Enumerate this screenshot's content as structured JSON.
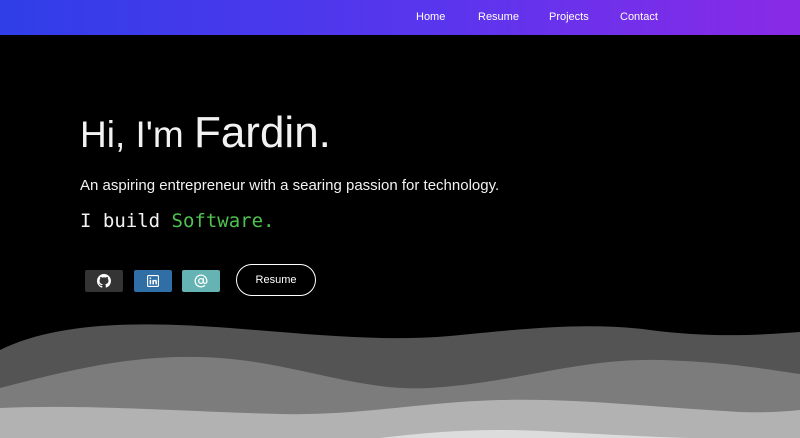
{
  "nav": {
    "items": [
      {
        "label": "Home"
      },
      {
        "label": "Resume"
      },
      {
        "label": "Projects"
      },
      {
        "label": "Contact"
      }
    ]
  },
  "hero": {
    "greeting_prefix": "Hi, I'm",
    "name": "Fardin.",
    "tagline": "An aspiring entrepreneur with a searing passion for technology.",
    "build_prefix": "I build",
    "build_word": "Software."
  },
  "social": {
    "github_icon": "github-icon",
    "linkedin_icon": "linkedin-icon",
    "email_icon": "at-sign-icon"
  },
  "resume_button": {
    "label": "Resume"
  },
  "colors": {
    "nav_gradient_start": "#2f3ee8",
    "nav_gradient_end": "#8a2ae6",
    "accent_green": "#4fc24f",
    "github_bg": "#343434",
    "linkedin_bg": "#2f6fa6",
    "email_bg": "#66b3b3"
  }
}
